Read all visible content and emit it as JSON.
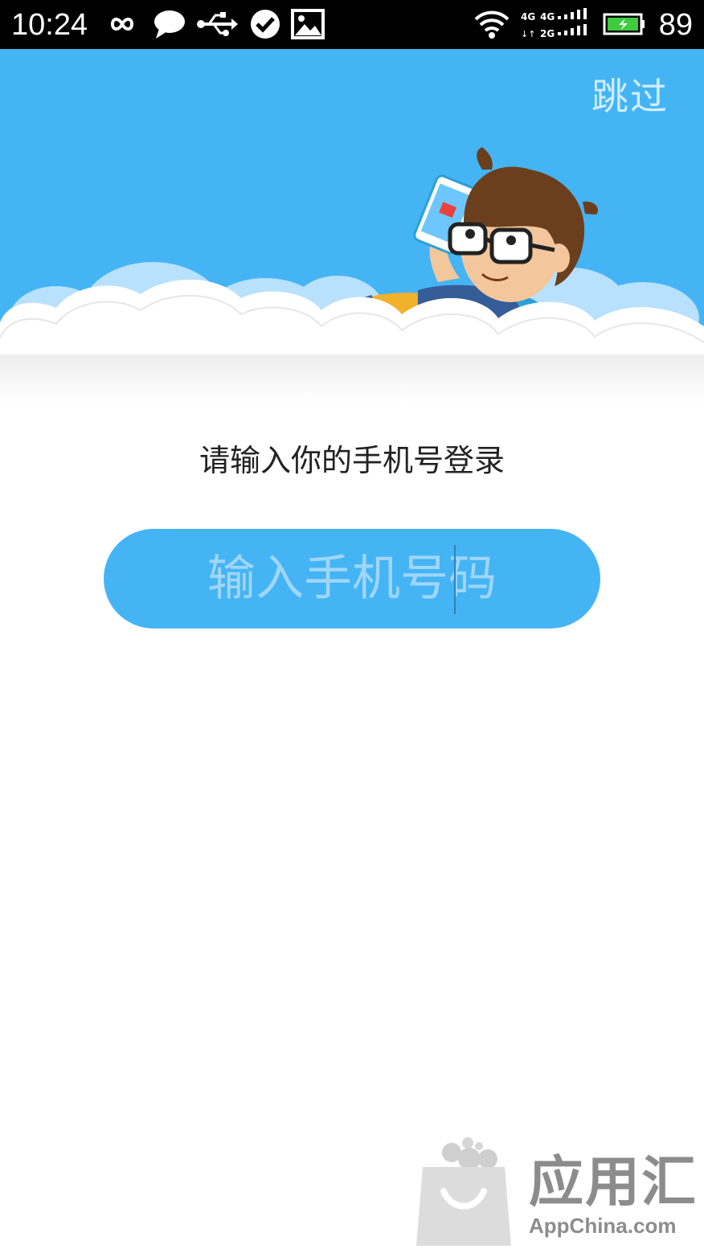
{
  "status_bar": {
    "time": "10:24",
    "battery": "89",
    "icons": [
      "infinity-icon",
      "chat-bubble-icon",
      "usb-icon",
      "check-circle-icon",
      "image-icon",
      "wifi-icon",
      "signal-4g-icon",
      "battery-icon"
    ],
    "network_top": "4G 4G",
    "network_bottom": "2G"
  },
  "header": {
    "skip_label": "跳过",
    "background_color": "#45b4f4",
    "illustration": "cartoon-boy-on-cloud-with-phone"
  },
  "login": {
    "prompt": "请输入你的手机号登录",
    "phone_input_placeholder": "输入手机号码",
    "phone_input_value": ""
  },
  "watermark": {
    "brand": "应用汇",
    "domain": "AppChina.com"
  },
  "colors": {
    "accent": "#45b4f4",
    "placeholder": "#9fd6f8",
    "skip_text": "#cfeeff",
    "watermark": "#8c8c8c"
  }
}
